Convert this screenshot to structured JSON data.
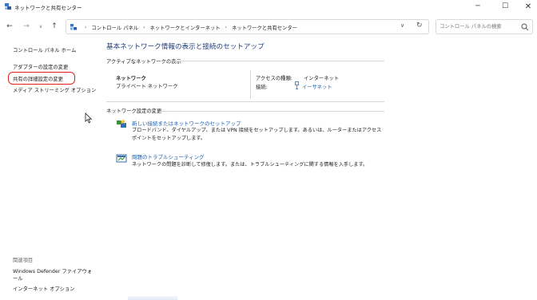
{
  "window": {
    "title": "ネットワークと共有センター",
    "min_glyph": "─",
    "max_glyph": "☐",
    "close_glyph": "✕"
  },
  "nav": {
    "back_glyph": "←",
    "forward_glyph": "→",
    "recent_glyph": "∨",
    "up_glyph": "↑",
    "breadcrumbs": [
      "コントロール パネル",
      "ネットワークとインターネット",
      "ネットワークと共有センター"
    ],
    "crumb_sep": "›",
    "dropdown_glyph": "∨",
    "refresh_glyph": "↻"
  },
  "search": {
    "placeholder": "コントロール パネルの検索"
  },
  "sidebar": {
    "home": "コントロール パネル ホーム",
    "items": [
      {
        "label": "アダプターの設定の変更"
      },
      {
        "label": "共有の詳細設定の変更"
      },
      {
        "label": "メディア ストリーミング オプション"
      }
    ],
    "related_title": "関連項目",
    "related": [
      {
        "label": "Windows Defender ファイアウォール"
      },
      {
        "label": "インターネット オプション"
      }
    ]
  },
  "main": {
    "title": "基本ネットワーク情報の表示と接続のセットアップ",
    "active_section": "アクティブなネットワークの表示",
    "network": {
      "name": "ネットワーク",
      "type": "プライベート ネットワーク",
      "access_label": "アクセスの種類:",
      "access_value": "インターネット",
      "connection_label": "接続:",
      "connection_value": "イーサネット"
    },
    "change_section": "ネットワーク設定の変更",
    "tasks": [
      {
        "title": "新しい接続またはネットワークのセットアップ",
        "desc": "ブロードバンド、ダイヤルアップ、または VPN 接続をセットアップします。あるいは、ルーターまたはアクセス ポイントをセットアップします。",
        "icon": "network-setup-icon"
      },
      {
        "title": "問題のトラブルシューティング",
        "desc": "ネットワークの問題を診断して修復します。または、トラブルシューティングに関する情報を入手します。",
        "icon": "troubleshoot-icon"
      }
    ]
  },
  "colors": {
    "link": "#1a5fb4",
    "title": "#1f3d7a",
    "highlight": "#e0201a"
  }
}
